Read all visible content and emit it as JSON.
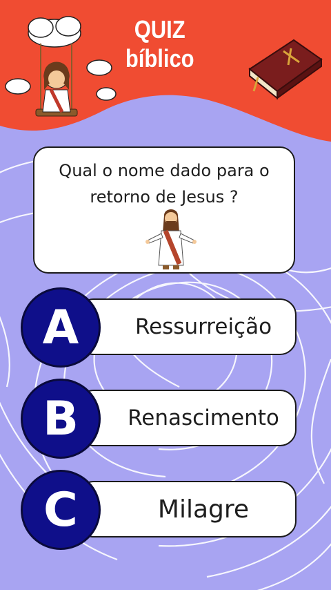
{
  "header": {
    "title": "QUIZ bíblico"
  },
  "question": {
    "text": "Qual o nome dado para o retorno de Jesus ?"
  },
  "answers": [
    {
      "letter": "A",
      "text": "Ressurreição"
    },
    {
      "letter": "B",
      "text": "Renascimento"
    },
    {
      "letter": "C",
      "text": "Milagre"
    }
  ],
  "colors": {
    "header_red": "#f04c32",
    "background_lavender": "#a8a4f2",
    "badge_navy": "#0f0f8a",
    "card_white": "#ffffff"
  },
  "icons": [
    "cloud-swing-jesus-icon",
    "bible-book-icon",
    "jesus-figure-icon",
    "cloud-icon"
  ]
}
